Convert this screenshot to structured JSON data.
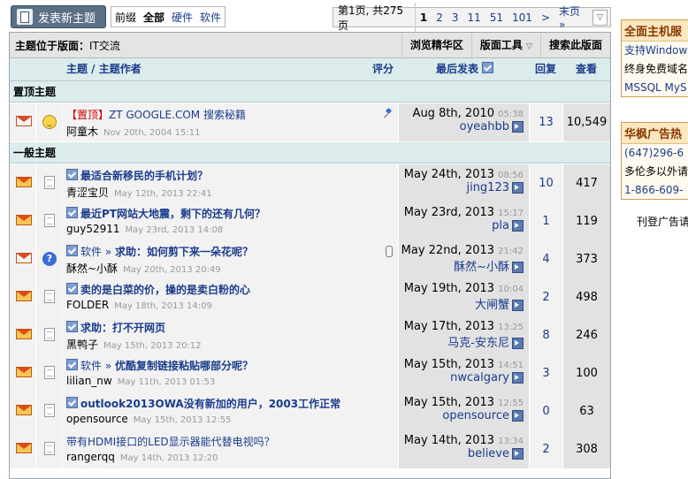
{
  "toolbar": {
    "new_topic": "发表新主题",
    "filters": [
      "前缀",
      "全部",
      "硬件",
      "软件"
    ],
    "active_filter": "全部"
  },
  "pager": {
    "info": "第1页, 共275页",
    "pages": [
      "1",
      "2",
      "3",
      "11",
      "51",
      "101"
    ],
    "current": "1",
    "next": ">",
    "last": "末页 »"
  },
  "forum_bar": {
    "crumb_label": "主题位于版面：",
    "crumb_value": "IT交流",
    "tools": [
      "浏览精华区",
      "版面工具",
      "搜索此版面"
    ]
  },
  "columns": {
    "topic_author": "主题 / 主题作者",
    "rating": "评分",
    "last_post": "最后发表",
    "replies": "回复",
    "views": "查看"
  },
  "sections": {
    "pinned": "置顶主题",
    "general": "一般主题"
  },
  "pinned_topics": [
    {
      "prefix": "【置顶】",
      "title": "ZT GOOGLE.COM 搜索秘籍",
      "author": "阿童木",
      "date": "Nov 20th, 2004 15:11",
      "last_date": "Aug 8th, 2010",
      "last_time": "05:38",
      "last_user": "oyeahbb",
      "replies": "13",
      "views": "10,549"
    }
  ],
  "topics": [
    {
      "board": "",
      "title": "最适合新移民的手机计划？",
      "author": "青涩宝贝",
      "date": "May 12th, 2013 22:41",
      "last_date": "May 24th, 2013",
      "last_time": "08:56",
      "last_user": "jing123",
      "replies": "10",
      "views": "417"
    },
    {
      "board": "",
      "title": "最近PT网站大地震，剩下的还有几何？",
      "author": "guy52911",
      "date": "May 23rd, 2013 14:08",
      "last_date": "May 23rd, 2013",
      "last_time": "15:17",
      "last_user": "pla",
      "replies": "1",
      "views": "119"
    },
    {
      "board": "软件 » ",
      "title": "求助：如何剪下来一朵花呢？",
      "author": "酥然~小酥",
      "date": "May 20th, 2013 20:49",
      "last_date": "May 22nd, 2013",
      "last_time": "21:42",
      "last_user": "酥然~小酥",
      "replies": "4",
      "views": "373"
    },
    {
      "board": "",
      "title": "卖的是白菜的价，操的是卖白粉的心",
      "author": "FOLDER",
      "date": "May 18th, 2013 14:09",
      "last_date": "May 19th, 2013",
      "last_time": "10:04",
      "last_user": "大闸蟹",
      "replies": "2",
      "views": "498"
    },
    {
      "board": "",
      "title": "求助：打不开网页",
      "author": "黑鸭子",
      "date": "May 15th, 2013 20:12",
      "last_date": "May 17th, 2013",
      "last_time": "13:25",
      "last_user": "马克-安东尼",
      "replies": "8",
      "views": "246"
    },
    {
      "board": "软件 » ",
      "title": "优酷复制链接粘贴哪部分呢？",
      "author": "lilian_nw",
      "date": "May 11th, 2013 01:53",
      "last_date": "May 15th, 2013",
      "last_time": "14:51",
      "last_user": "nwcalgary",
      "replies": "3",
      "views": "100"
    },
    {
      "board": "",
      "title": "outlook2013OWA没有新加的用户，2003工作正常",
      "author": "opensource",
      "date": "May 15th, 2013 12:55",
      "last_date": "May 15th, 2013",
      "last_time": "12:55",
      "last_user": "opensource",
      "replies": "0",
      "views": "63"
    },
    {
      "board": "",
      "title": "带有HDMI接口的LED显示器能代替电视吗？",
      "author": "rangerqq",
      "date": "May 14th, 2013 12:20",
      "last_date": "May 14th, 2013",
      "last_time": "13:34",
      "last_user": "believe",
      "replies": "2",
      "views": "308"
    }
  ],
  "sidebar": {
    "ad1": {
      "heading": "全面主机服",
      "lines": [
        "支持Window",
        "终身免费域名",
        "MSSQL MyS"
      ]
    },
    "ad2": {
      "heading": "华枫广告热",
      "lines": [
        "(647)296-6",
        "多伦多以外请",
        "1-866-609-"
      ]
    },
    "note": "刊登广告请"
  }
}
